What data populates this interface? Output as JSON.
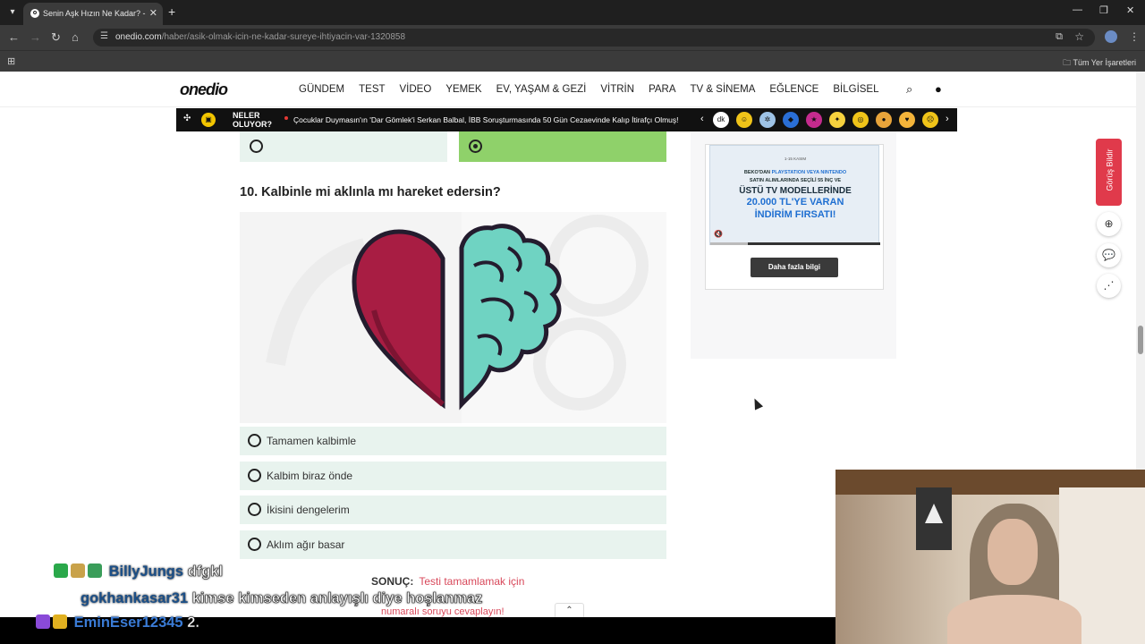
{
  "browser": {
    "tab_title": "Senin Aşk Hızın Ne Kadar? - Onedio",
    "url_host": "onedio.com",
    "url_path": "/haber/asik-olmak-icin-ne-kadar-sureye-ihtiyacin-var-1320858",
    "bookmarks_all": "Tüm Yer İşaretleri"
  },
  "site": {
    "logo": "onedio",
    "nav": [
      "GÜNDEM",
      "TEST",
      "VİDEO",
      "YEMEK",
      "EV, YAŞAM & GEZİ",
      "VİTRİN",
      "PARA",
      "TV & SİNEMA",
      "EĞLENCE",
      "BİLGİSEL"
    ],
    "newsbar_title_1": "NELER",
    "newsbar_title_2": "OLUYOR?",
    "newsbar_headline": "Çocuklar Duymasın'ın 'Dar Gömlek'i Serkan Balbal, İBB Soruşturmasında 50 Gün Cezaevinde Kalıp İtirafçı Olmuş!"
  },
  "quiz": {
    "question": "10. Kalbinle mi aklınla mı hareket edersin?",
    "options": [
      "Tamamen kalbimle",
      "Kalbim biraz önde",
      "İkisini dengelerim",
      "Aklım ağır basar"
    ],
    "result_label": "SONUÇ:",
    "result_text_1": "Testi tamamlamak için",
    "result_text_2": "numaralı soruyu cevaplayın!"
  },
  "ad": {
    "date": "1-15 KASIM",
    "line1_pre": "BEKO'DAN",
    "line1_brand": "PLAYSTATION VEYA NINTENDO",
    "line2": "SATIN ALIMLARINDA SEÇİLİ 55 İNÇ VE",
    "line3": "ÜSTÜ TV MODELLERİNDE",
    "line4": "20.000 TL'YE VARAN",
    "line5": "İNDİRİM FIRSATI!",
    "button": "Daha fazla bilgi"
  },
  "feedback_label": "Görüş Bildir",
  "chat": [
    {
      "user": "BillyJungs",
      "message": "dfgkl"
    },
    {
      "user": "gokhankasar31",
      "message": "kimse kimseden anlayışlı diye hoşlanmaz"
    },
    {
      "user": "EminEser12345",
      "message": "2."
    }
  ],
  "colors": {
    "answer_bg": "#e8f3ee",
    "selected_bg": "#8fd16a",
    "result_red": "#d8485a",
    "feedback_red": "#e03a4b"
  }
}
